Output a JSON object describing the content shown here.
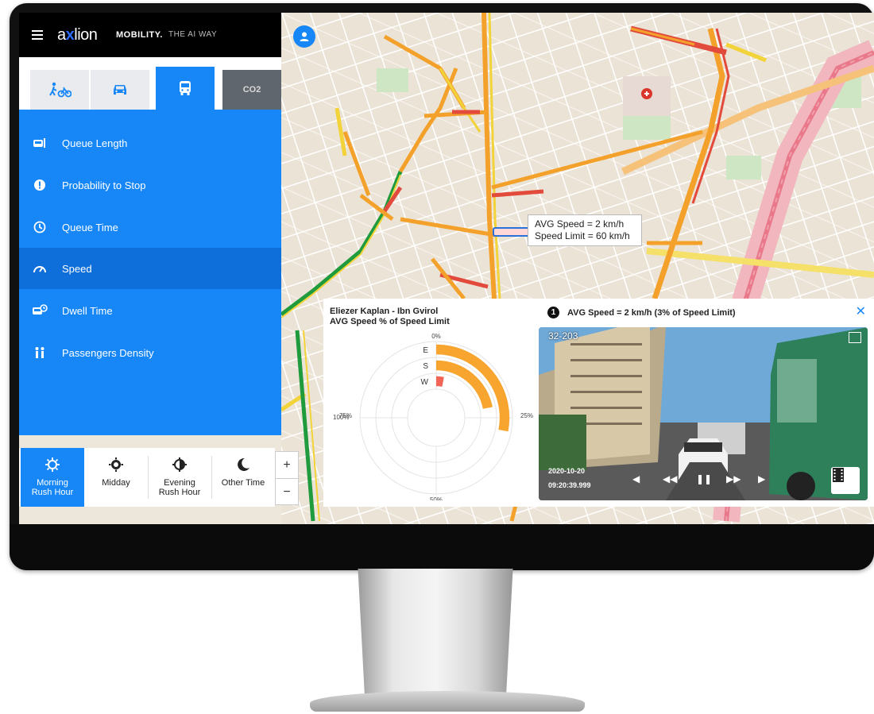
{
  "header": {
    "logo_text_a": "a",
    "logo_text_x": "x",
    "logo_text_rest": "lion",
    "brand": "MOBILITY.",
    "tagline": "THE AI WAY"
  },
  "tabs": [
    {
      "name": "pedestrian-bike",
      "icon": "pedestrian-bike-icon"
    },
    {
      "name": "car",
      "icon": "car-icon"
    },
    {
      "name": "bus",
      "icon": "bus-icon",
      "active": true
    },
    {
      "name": "co2",
      "label": "CO2"
    }
  ],
  "menu": [
    {
      "label": "Queue Length",
      "icon": "queue-length-icon"
    },
    {
      "label": "Probability to Stop",
      "icon": "alert-icon"
    },
    {
      "label": "Queue Time",
      "icon": "clock-icon"
    },
    {
      "label": "Speed",
      "icon": "speedometer-icon",
      "active": true
    },
    {
      "label": "Dwell Time",
      "icon": "bus-stop-icon"
    },
    {
      "label": "Passengers Density",
      "icon": "passengers-icon"
    }
  ],
  "time_periods": [
    {
      "label_1": "Morning",
      "label_2": "Rush Hour",
      "icon": "sun-icon",
      "active": true
    },
    {
      "label_1": "Midday",
      "label_2": "",
      "icon": "sun-full-icon"
    },
    {
      "label_1": "Evening",
      "label_2": "Rush Hour",
      "icon": "half-sun-icon"
    },
    {
      "label_1": "Other Time",
      "label_2": "",
      "icon": "moon-icon"
    }
  ],
  "zoom": {
    "plus": "+",
    "minus": "−"
  },
  "tooltip": {
    "line1": "AVG Speed = 2 km/h",
    "line2": "Speed Limit = 60 km/h"
  },
  "panel": {
    "chart_title_1": "Eliezer Kaplan - Ibn Gvirol",
    "chart_title_2": "AVG Speed % of Speed Limit",
    "video_badge": "1",
    "video_title": "AVG Speed = 2 km/h (3% of Speed Limit)",
    "close": "✕",
    "video_corner": "32-203",
    "video_date": "2020-10-20",
    "video_time": "09:20:39.999"
  },
  "chart_data": {
    "type": "radial-bar",
    "title": "AVG Speed % of Speed Limit",
    "categories": [
      "E",
      "S",
      "W"
    ],
    "values": [
      28,
      22,
      3
    ],
    "tick_labels": [
      "0%",
      "25%",
      "50%",
      "75%",
      "100%"
    ],
    "colors": {
      "E": "#f7a52e",
      "S": "#f7a52e",
      "W": "#f26455"
    }
  },
  "colors": {
    "accent": "#1787f7",
    "menu_active": "#0e6fdb",
    "traffic_green": "#1f9a3c",
    "traffic_yellow": "#f2d33a",
    "traffic_orange": "#f3a12a",
    "traffic_red": "#e24a3b",
    "major_road": "#f6c9cf"
  }
}
